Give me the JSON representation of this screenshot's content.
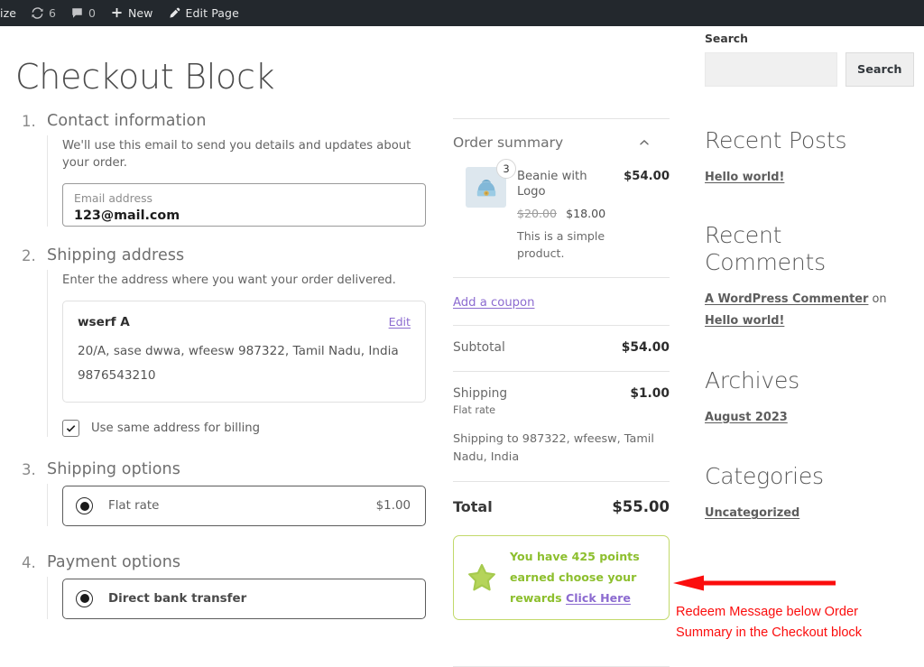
{
  "adminbar": {
    "customize_label": "ize",
    "updates_icon": "update-icon",
    "updates_count": "6",
    "comments_icon": "comment-icon",
    "comments_count": "0",
    "new_icon": "plus-icon",
    "new_label": "New",
    "edit_icon": "pencil-icon",
    "edit_label": "Edit Page"
  },
  "page": {
    "title": "Checkout Block"
  },
  "checkout": {
    "steps": [
      {
        "number": "1.",
        "title": "Contact information",
        "description": "We'll use this email to send you details and updates about your order.",
        "field_label": "Email address",
        "field_value": "123@mail.com",
        "field_placeholder": "Email address"
      },
      {
        "number": "2.",
        "title": "Shipping address",
        "description": "Enter the address where you want your order delivered.",
        "address_name": "wserf A",
        "address_line1": "20/A, sase dwwa, wfeesw 987322, Tamil Nadu, India",
        "address_line2": "9876543210",
        "edit_label": "Edit",
        "billing_checkbox_label": "Use same address for billing",
        "billing_checkbox_checked": true
      },
      {
        "number": "3.",
        "title": "Shipping options",
        "option_label": "Flat rate",
        "option_price": "$1.00",
        "option_selected": true
      },
      {
        "number": "4.",
        "title": "Payment options",
        "option_label": "Direct bank transfer",
        "option_selected": true
      }
    ]
  },
  "order_summary": {
    "title": "Order summary",
    "collapse_icon": "chevron-up-icon",
    "product": {
      "thumb_icon": "beanie-product-image",
      "quantity": "3",
      "name": "Beanie with Logo",
      "line_total": "$54.00",
      "price_old": "$20.00",
      "price_new": "$18.00",
      "description": "This is a simple product."
    },
    "coupon_link": "Add a coupon",
    "rows": [
      {
        "label": "Subtotal",
        "value": "$54.00",
        "sub": ""
      },
      {
        "label": "Shipping",
        "value": "$1.00",
        "sub": "Flat rate"
      }
    ],
    "shipping_to": "Shipping to 987322, wfeesw, Tamil Nadu, India",
    "total_label": "Total",
    "total_value": "$55.00",
    "rewards": {
      "icon": "star-icon",
      "text": "You have 425 points earned choose your rewards ",
      "link_label": "Click Here",
      "border_color": "#c2d96a",
      "text_color": "#8dbf2e",
      "link_color": "#8c6bd0"
    }
  },
  "sidebar": {
    "search": {
      "label": "Search",
      "value": "",
      "placeholder": "",
      "button_label": "Search"
    },
    "recent_posts": {
      "heading": "Recent Posts",
      "items": [
        "Hello world!"
      ]
    },
    "recent_comments": {
      "heading": "Recent Comments",
      "author": "A WordPress Commenter",
      "connector": " on ",
      "post": "Hello world!"
    },
    "archives": {
      "heading": "Archives",
      "items": [
        "August 2023"
      ]
    },
    "categories": {
      "heading": "Categories",
      "items": [
        "Uncategorized"
      ]
    }
  },
  "annotation": {
    "arrow_icon": "left-arrow-annotation",
    "line1": "Redeem Message below Order",
    "line2": "Summary in the Checkout block",
    "color": "#fb0d0d"
  }
}
